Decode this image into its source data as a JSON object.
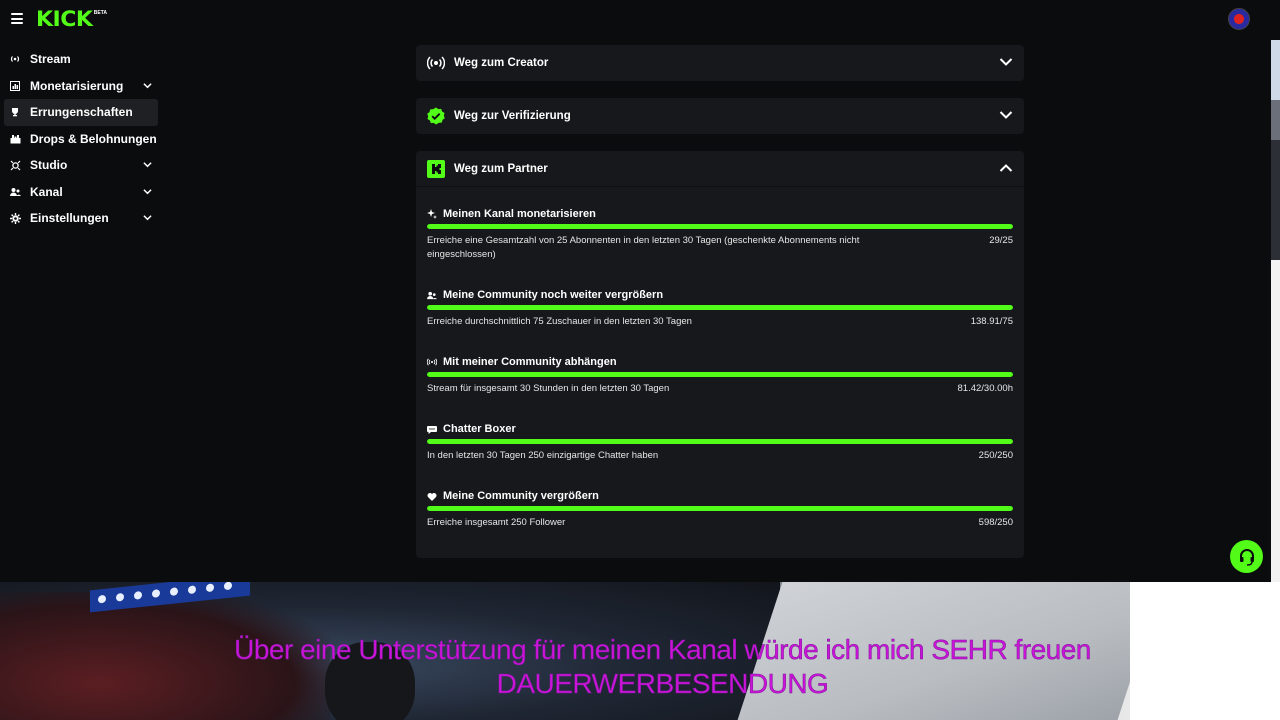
{
  "header": {
    "logo_text": "KICK",
    "logo_badge": "BETA"
  },
  "sidebar": {
    "items": [
      {
        "label": "Stream",
        "icon": "broadcast-icon",
        "has_chevron": false,
        "active": false
      },
      {
        "label": "Monetarisierung",
        "icon": "chart-icon",
        "has_chevron": true,
        "active": false
      },
      {
        "label": "Errungenschaften",
        "icon": "trophy-icon",
        "has_chevron": false,
        "active": true
      },
      {
        "label": "Drops & Belohnungen",
        "icon": "gift-icon",
        "has_chevron": false,
        "active": false
      },
      {
        "label": "Studio",
        "icon": "studio-icon",
        "has_chevron": true,
        "active": false
      },
      {
        "label": "Kanal",
        "icon": "users-icon",
        "has_chevron": true,
        "active": false
      },
      {
        "label": "Einstellungen",
        "icon": "gear-icon",
        "has_chevron": true,
        "active": false
      }
    ]
  },
  "cards": [
    {
      "title": "Weg zum Creator",
      "icon": "broadcast-icon",
      "expanded": false
    },
    {
      "title": "Weg zur Verifizierung",
      "icon": "verified-badge-icon",
      "expanded": false
    },
    {
      "title": "Weg zum Partner",
      "icon": "kick-logo-icon",
      "expanded": true
    }
  ],
  "partner_sections": [
    {
      "title": "Meinen Kanal monetarisieren",
      "icon": "sparkle-icon",
      "desc": "Erreiche eine Gesamtzahl von 25 Abonnenten in den letzten 30 Tagen (geschenkte Abonnements nicht eingeschlossen)",
      "value": "29/25",
      "progress": 1.0
    },
    {
      "title": "Meine Community noch weiter vergrößern",
      "icon": "users-icon",
      "desc": "Erreiche durchschnittlich 75 Zuschauer in den letzten 30 Tagen",
      "value": "138.91/75",
      "progress": 1.0
    },
    {
      "title": "Mit meiner Community abhängen",
      "icon": "broadcast-icon",
      "desc": "Stream für insgesamt 30 Stunden in den letzten 30 Tagen",
      "value": "81.42/30.00h",
      "progress": 1.0
    },
    {
      "title": "Chatter Boxer",
      "icon": "chat-icon",
      "desc": "In den letzten 30 Tagen 250 einzigartige Chatter haben",
      "value": "250/250",
      "progress": 1.0
    },
    {
      "title": "Meine Community vergrößern",
      "icon": "heart-icon",
      "desc": "Erreiche insgesamt 250 Follower",
      "value": "598/250",
      "progress": 1.0
    }
  ],
  "overlay": {
    "line1": "Über eine Unterstützung für meinen Kanal würde ich mich SEHR freuen",
    "line2": "DAUERWERBESENDUNG"
  },
  "colors": {
    "accent": "#53fc18",
    "card_bg": "#17181c",
    "page_bg": "#0b0c0e",
    "overlay_text": "#cc14d8"
  }
}
